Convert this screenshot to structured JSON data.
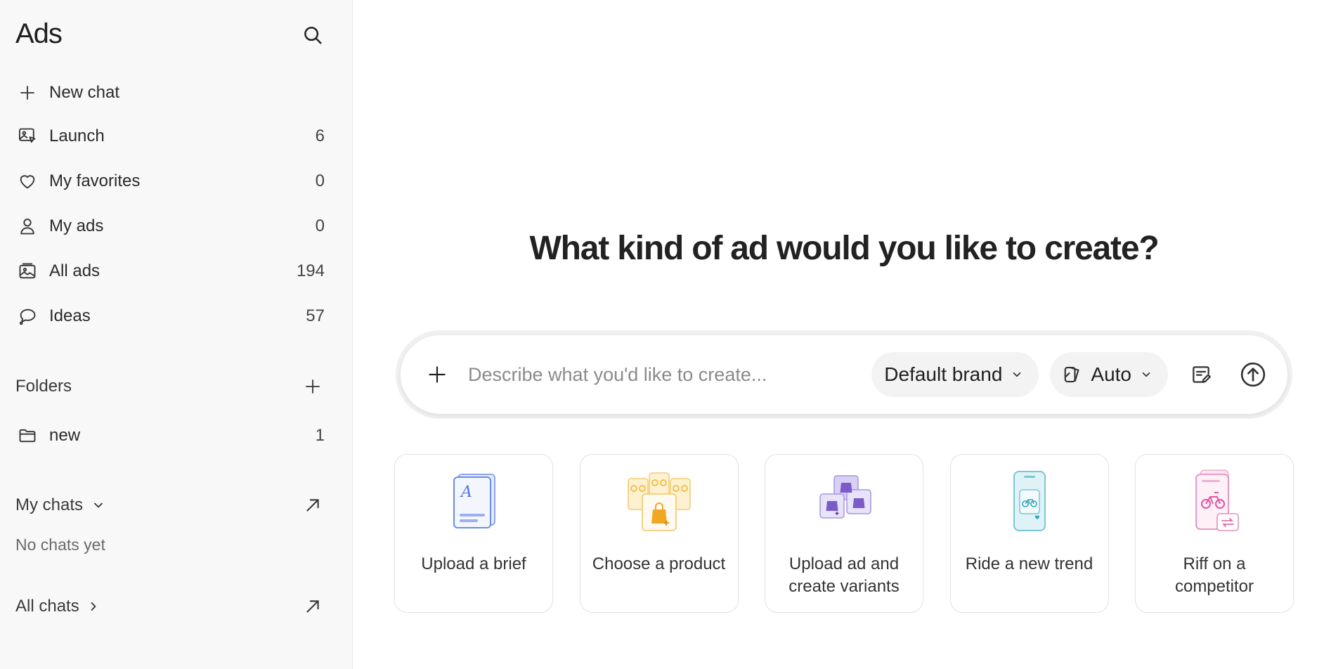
{
  "sidebar": {
    "title": "Ads",
    "nav": [
      {
        "label": "New chat",
        "count": "",
        "icon": "plus-icon"
      },
      {
        "label": "Launch",
        "count": "6",
        "icon": "launch-icon"
      },
      {
        "label": "My favorites",
        "count": "0",
        "icon": "heart-icon"
      },
      {
        "label": "My ads",
        "count": "0",
        "icon": "person-icon"
      },
      {
        "label": "All ads",
        "count": "194",
        "icon": "images-icon"
      },
      {
        "label": "Ideas",
        "count": "57",
        "icon": "chat-bubble-icon"
      }
    ],
    "folders": {
      "label": "Folders",
      "items": [
        {
          "label": "new",
          "count": "1",
          "icon": "folder-icon"
        }
      ]
    },
    "my_chats": {
      "label": "My chats",
      "empty": "No chats yet"
    },
    "all_chats": {
      "label": "All chats"
    }
  },
  "main": {
    "headline": "What kind of ad would you like to create?",
    "composer": {
      "placeholder": "Describe what you'd like to create...",
      "brand": "Default brand",
      "mode": "Auto"
    },
    "cards": [
      {
        "label": "Upload a brief",
        "icon": "brief-document-icon"
      },
      {
        "label": "Choose a product",
        "icon": "product-cards-icon"
      },
      {
        "label": "Upload ad and create variants",
        "icon": "ad-variants-icon"
      },
      {
        "label": "Ride a new trend",
        "icon": "phone-trend-icon"
      },
      {
        "label": "Riff on a competitor",
        "icon": "competitor-riff-icon"
      }
    ]
  },
  "colors": {
    "sidebar_bg": "#f8f8f8",
    "card_blue": "#6b8ce8",
    "card_yellow": "#f2b233",
    "card_purple": "#7a5cc9",
    "card_teal": "#2aa6b8",
    "card_pink": "#e055a6"
  }
}
